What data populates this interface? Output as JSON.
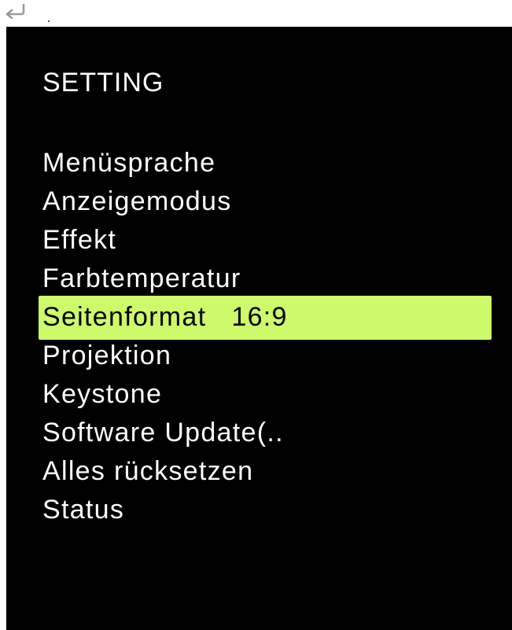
{
  "top_bar": {
    "return_icon": "return-arrow-icon"
  },
  "osd": {
    "title": "SETTING",
    "menu_items": [
      {
        "label": "Menüsprache",
        "value": ""
      },
      {
        "label": "Anzeigemodus",
        "value": ""
      },
      {
        "label": "Effekt",
        "value": ""
      },
      {
        "label": "Farbtemperatur",
        "value": ""
      },
      {
        "label": "Seitenformat",
        "value": "16:9",
        "selected": true
      },
      {
        "label": "Projektion",
        "value": ""
      },
      {
        "label": "Keystone",
        "value": ""
      },
      {
        "label": "Software Update(..",
        "value": ""
      },
      {
        "label": "Alles rücksetzen",
        "value": ""
      },
      {
        "label": "Status",
        "value": ""
      }
    ],
    "colors": {
      "background": "#000000",
      "text": "#ffffff",
      "highlight": "#cdfa6b",
      "highlight_text": "#000000"
    }
  }
}
